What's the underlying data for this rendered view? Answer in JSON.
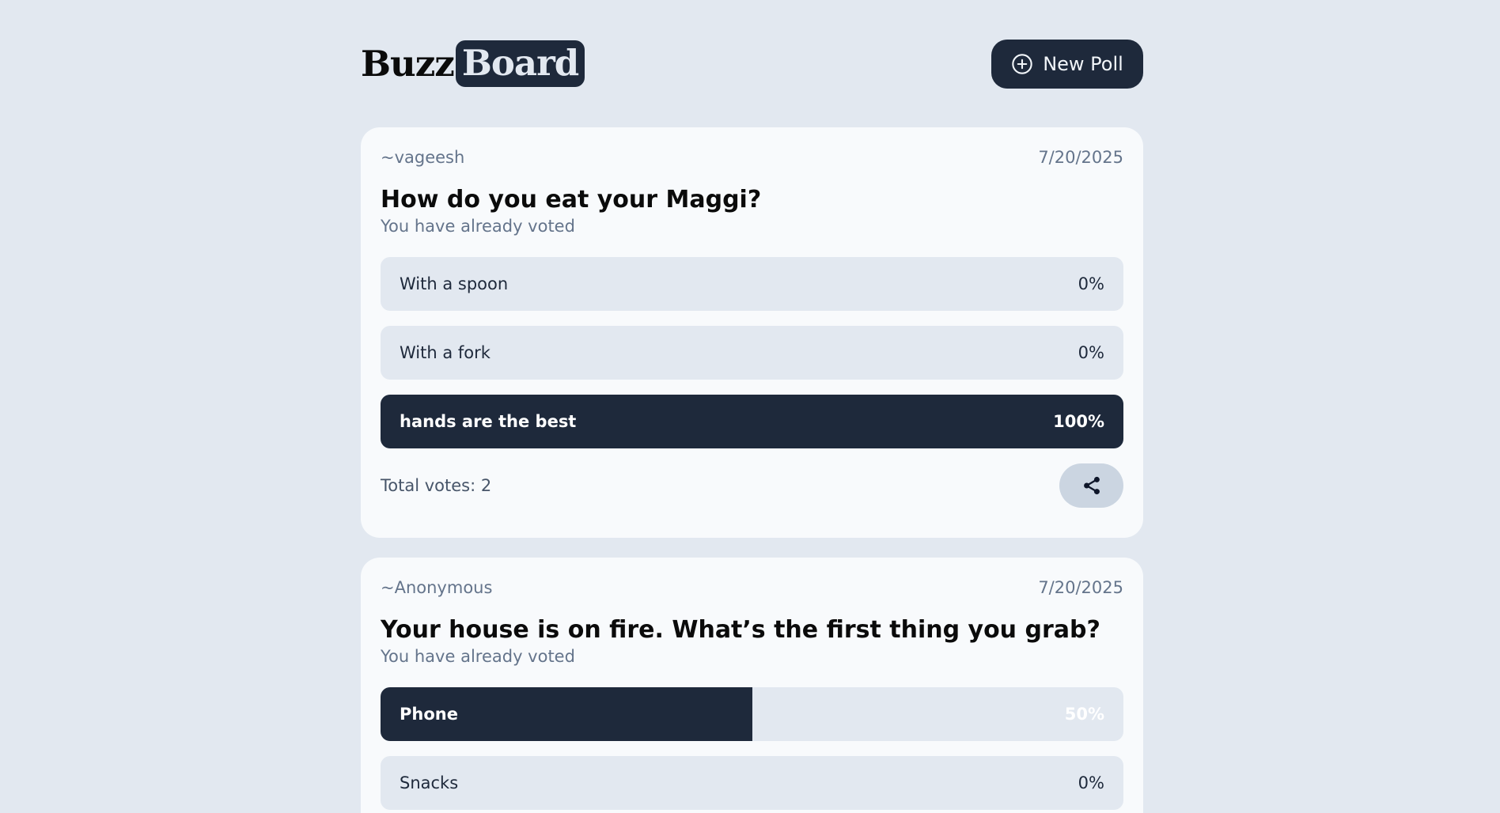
{
  "header": {
    "logo_part1": "Buzz",
    "logo_part2": "Board",
    "new_poll_label": "New Poll"
  },
  "polls": [
    {
      "author": "~vageesh",
      "date": "7/20/2025",
      "question": "How do you eat your Maggi?",
      "status": "You have already voted",
      "options": [
        {
          "label": "With a spoon",
          "percent": "0%",
          "share": 0
        },
        {
          "label": "With a fork",
          "percent": "0%",
          "share": 0
        },
        {
          "label": "hands are the best",
          "percent": "100%",
          "share": 100
        }
      ],
      "total_votes": "Total votes: 2"
    },
    {
      "author": "~Anonymous",
      "date": "7/20/2025",
      "question": "Your house is on fire. What’s the first thing you grab?",
      "status": "You have already voted",
      "options": [
        {
          "label": "Phone",
          "percent": "50%",
          "share": 50
        },
        {
          "label": "Snacks",
          "percent": "0%",
          "share": 0
        }
      ]
    }
  ],
  "colors": {
    "background": "#e2e8f0",
    "card": "#f8fafc",
    "accent": "#1e293b",
    "muted": "#64748b"
  }
}
